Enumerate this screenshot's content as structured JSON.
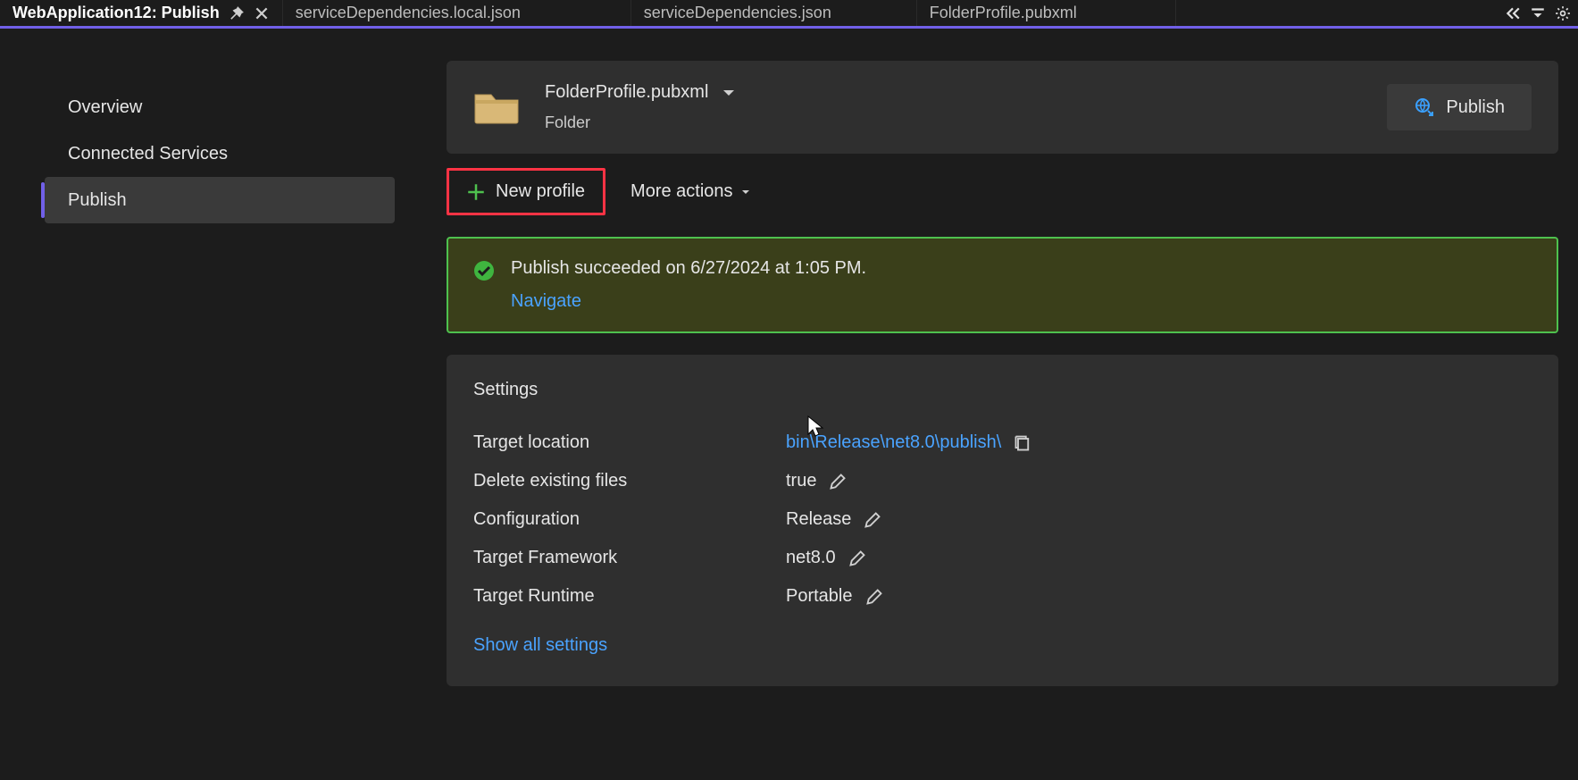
{
  "tabs": {
    "items": [
      {
        "label": "WebApplication12: Publish"
      },
      {
        "label": "serviceDependencies.local.json"
      },
      {
        "label": "serviceDependencies.json"
      },
      {
        "label": "FolderProfile.pubxml"
      }
    ]
  },
  "sidebar": {
    "items": [
      {
        "label": "Overview"
      },
      {
        "label": "Connected Services"
      },
      {
        "label": "Publish"
      }
    ]
  },
  "profile": {
    "name": "FolderProfile.pubxml",
    "type": "Folder",
    "publish_button": "Publish"
  },
  "toolbar": {
    "new_profile": "New profile",
    "more_actions": "More actions"
  },
  "banner": {
    "message": "Publish succeeded on 6/27/2024 at 1:05 PM.",
    "navigate": "Navigate"
  },
  "settings": {
    "title": "Settings",
    "rows": {
      "target_location": {
        "label": "Target location",
        "value": "bin\\Release\\net8.0\\publish\\"
      },
      "delete_existing": {
        "label": "Delete existing files",
        "value": "true"
      },
      "configuration": {
        "label": "Configuration",
        "value": "Release"
      },
      "target_framework": {
        "label": "Target Framework",
        "value": "net8.0"
      },
      "target_runtime": {
        "label": "Target Runtime",
        "value": "Portable"
      }
    },
    "show_all": "Show all settings"
  }
}
